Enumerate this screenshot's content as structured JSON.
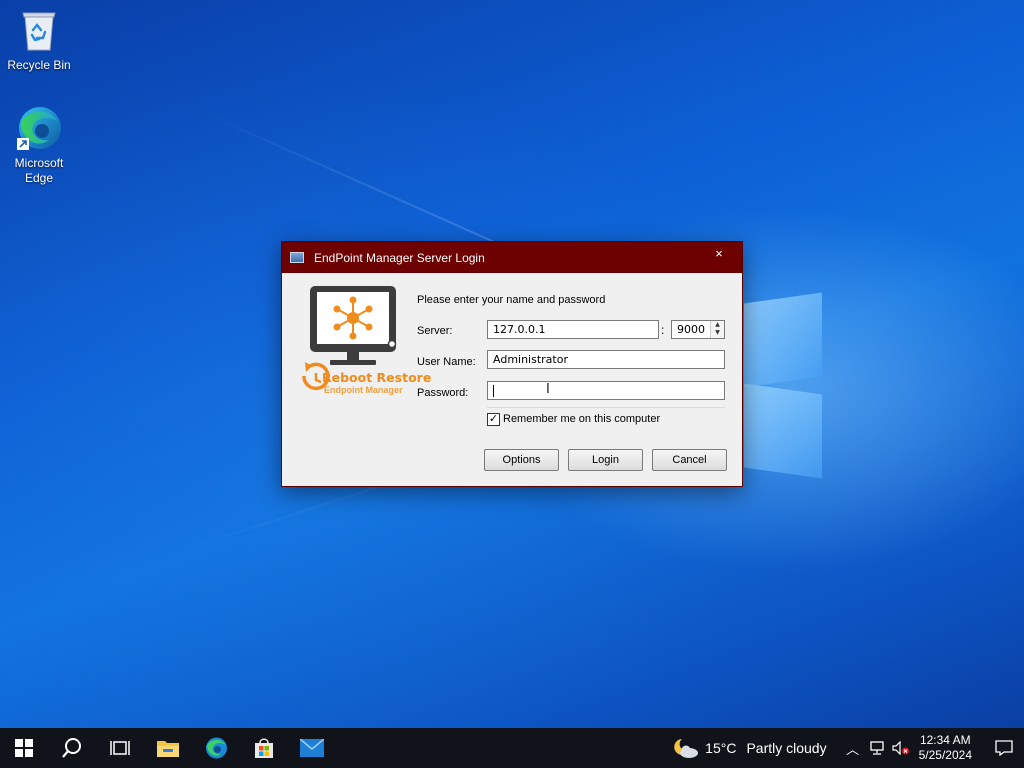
{
  "desktop": {
    "icons": [
      {
        "label": "Recycle Bin"
      },
      {
        "label": "Microsoft\nEdge"
      }
    ]
  },
  "dialog": {
    "title": "EndPoint Manager Server Login",
    "close_glyph": "×",
    "brand": {
      "line1": "Reboot Restore",
      "line2": "Endpoint Manager"
    },
    "prompt": "Please enter your name and password",
    "server_label": "Server:",
    "server_value": "127.0.0.1",
    "port_separator": ":",
    "port_value": "9000",
    "username_label": "User Name:",
    "username_value": "Administrator",
    "password_label": "Password:",
    "password_value": "",
    "remember_label": "Remember me on this computer",
    "remember_checked": true,
    "buttons": {
      "options": "Options",
      "login": "Login",
      "cancel": "Cancel"
    }
  },
  "taskbar": {
    "weather": {
      "temp": "15°C",
      "condition": "Partly cloudy"
    },
    "clock": {
      "time": "12:34 AM",
      "date": "5/25/2024"
    }
  },
  "colors": {
    "titlebar": "#6d0000",
    "brand_orange": "#f08c1e",
    "taskbar": "#10131a"
  }
}
